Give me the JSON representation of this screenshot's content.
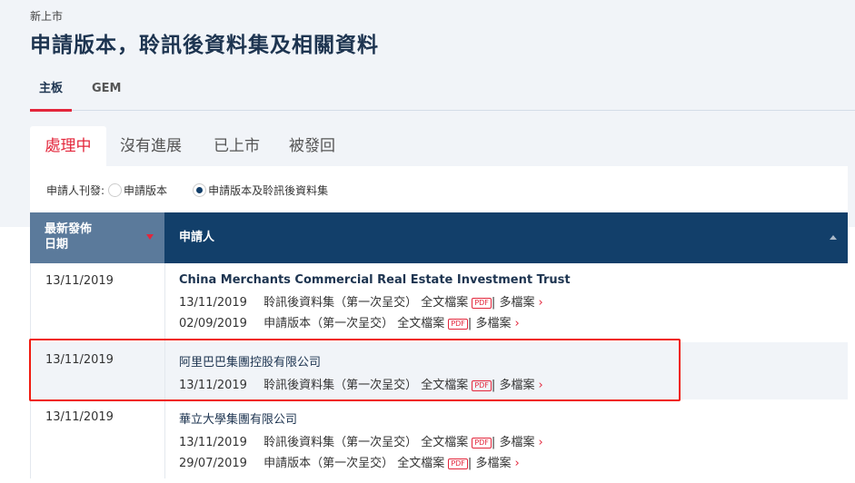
{
  "breadcrumb": "新上市",
  "title": "申請版本，聆訊後資料集及相關資料",
  "main_tabs": [
    "主板",
    "GEM"
  ],
  "sub_tabs": [
    "處理中",
    "沒有進展",
    "已上市",
    "被發回"
  ],
  "filter": {
    "label": "申請人刊發:",
    "options": [
      "申請版本",
      "申請版本及聆訊後資料集"
    ],
    "selected": 1
  },
  "table": {
    "headers": [
      "最新發佈",
      "日期",
      "申請人"
    ],
    "rows": [
      {
        "date": "13/11/2019",
        "name": "China Merchants Commercial Real Estate Investment Trust",
        "docs": [
          {
            "date": "13/11/2019",
            "type": "聆訊後資料集（第一次呈交）",
            "full": "全文檔案",
            "pdf": "PDF",
            "multi": "多檔案"
          },
          {
            "date": "02/09/2019",
            "type": "申請版本（第一次呈交）",
            "full": "全文檔案",
            "pdf": "PDF",
            "multi": "多檔案"
          }
        ]
      },
      {
        "date": "13/11/2019",
        "name": "阿里巴巴集團控股有限公司",
        "docs": [
          {
            "date": "13/11/2019",
            "type": "聆訊後資料集（第一次呈交）",
            "full": "全文檔案",
            "pdf": "PDF",
            "multi": "多檔案"
          }
        ]
      },
      {
        "date": "13/11/2019",
        "name": "華立大學集團有限公司",
        "docs": [
          {
            "date": "13/11/2019",
            "type": "聆訊後資料集（第一次呈交）",
            "full": "全文檔案",
            "pdf": "PDF",
            "multi": "多檔案"
          },
          {
            "date": "29/07/2019",
            "type": "申請版本（第一次呈交）",
            "full": "全文檔案",
            "pdf": "PDF",
            "multi": "多檔案"
          }
        ]
      }
    ]
  },
  "separator": "|",
  "chevron": "›"
}
